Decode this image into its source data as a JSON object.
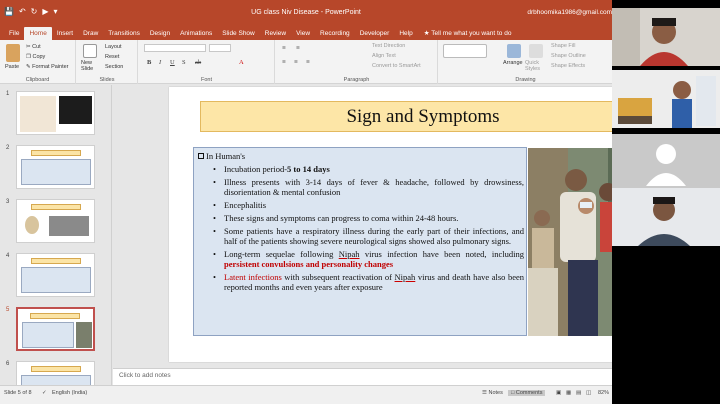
{
  "window": {
    "doc_title": "UG class Niv Disease",
    "app_name": "PowerPoint",
    "account": "drbhoomika1986@gmail.com",
    "accent": "#b7472a"
  },
  "ribbon_tabs": [
    "File",
    "Home",
    "Insert",
    "Draw",
    "Transitions",
    "Design",
    "Animations",
    "Slide Show",
    "Review",
    "View",
    "Recording",
    "Developer",
    "Help"
  ],
  "tell_me": "Tell me what you want to do",
  "ribbon": {
    "clipboard": {
      "label": "Clipboard",
      "paste": "Paste",
      "cut": "Cut",
      "copy": "Copy",
      "format_painter": "Format Painter"
    },
    "slides": {
      "label": "Slides",
      "new_slide": "New Slide",
      "layout": "Layout",
      "reset": "Reset",
      "section": "Section"
    },
    "font": {
      "label": "Font"
    },
    "paragraph": {
      "label": "Paragraph",
      "text_direction": "Text Direction",
      "align_text": "Align Text",
      "convert": "Convert to SmartArt"
    },
    "drawing": {
      "label": "Drawing",
      "arrange": "Arrange",
      "quick_styles": "Quick Styles",
      "shape_fill": "Shape Fill",
      "shape_outline": "Shape Outline",
      "shape_effects": "Shape Effects"
    }
  },
  "thumbnails": [
    {
      "num": "1"
    },
    {
      "num": "2"
    },
    {
      "num": "3"
    },
    {
      "num": "4"
    },
    {
      "num": "5"
    },
    {
      "num": "6"
    }
  ],
  "slide": {
    "title": "Sign and Symptoms",
    "heading": "In Human's",
    "b1_pre": "Incubation period-",
    "b1_bold": "5 to 14 days",
    "b2": "Illness presents with 3-14 days of fever & headache, followed by drowsiness, disorientation & mental confusion",
    "b3": "Encephalitis",
    "b4": "These signs and symptoms can progress to coma within 24-48 hours.",
    "b5": "Some patients have a respiratory illness during the early part of their infections, and half of the patients showing severe neurological signs showed also pulmonary signs.",
    "b6_pre": "Long-term sequelae following ",
    "b6_u": "Nipah",
    "b6_mid": " virus infection have been noted, including ",
    "b6_bold": "persistent convulsions and personality changes",
    "b7_red": "Latent infections",
    "b7_pre": " with subsequent reactivation of ",
    "b7_u": "Nipah",
    "b7_post": " virus and death have also been reported months and even years after exposure"
  },
  "notes_placeholder": "Click to add notes",
  "status": {
    "slide_of": "Slide 5 of 8",
    "language": "English (India)",
    "notes": "Notes",
    "comments": "Comments",
    "zoom": "82%"
  }
}
